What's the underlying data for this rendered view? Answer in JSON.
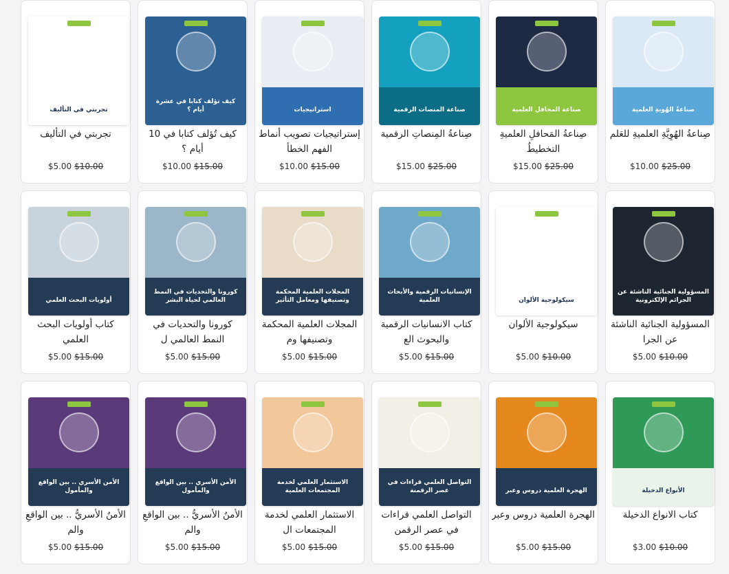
{
  "products": [
    {
      "title": "صِناعةُ الهُوِيَّةِ العلميةِ للعَلم",
      "price": "$10.00",
      "old_price": "$25.00",
      "cover": {
        "text": "صناعةُ الهُويةِ العلمية",
        "bg": "#dbe9f7",
        "band": "#5aa7d9",
        "icon": "world-map"
      }
    },
    {
      "title": "صِناعةُ المَحافلِ العلميةِ التخطيطُ",
      "price": "$15.00",
      "old_price": "$25.00",
      "cover": {
        "text": "صناعة المحافل العلمية",
        "bg": "#1e2a44",
        "band": "#8ec63f",
        "icon": "conference-hall"
      }
    },
    {
      "title": "صِناعةُ المِنصاتِ الرقمية",
      "price": "$15.00",
      "old_price": "$25.00",
      "cover": {
        "text": "صناعة المنصات الرقمية",
        "bg": "#14a0bf",
        "band": "#0c6d87",
        "icon": "cloud-network"
      }
    },
    {
      "title": "إستراتيجيات تصويب أنماط الفهم الخطأ",
      "price": "$10.00",
      "old_price": "$15.00",
      "cover": {
        "text": "استراتيجيات",
        "bg": "#e9eef4",
        "band": "#2f6fb1",
        "icon": "question-mark"
      }
    },
    {
      "title": "كيف تُؤلف كتابا في 10 أيام ؟",
      "price": "$10.00",
      "old_price": "$15.00",
      "cover": {
        "text": "كيف تؤلف كتابا في عشرة أيام ؟",
        "bg": "#2c5f92",
        "band": "#2c5f92",
        "icon": "laptop"
      }
    },
    {
      "title": "تجربتي في التأليف",
      "price": "$5.00",
      "old_price": "$10.00",
      "cover": {
        "text": "تجربتي في التأليف",
        "bg": "#ffffff",
        "band": "#ffffff",
        "icon": "document"
      }
    },
    {
      "title": "المسؤولية الجنائية الناشئة عن الجرا",
      "price": "$5.00",
      "old_price": "$10.00",
      "cover": {
        "text": "المسؤولية الجنائية الناشئة عن الجرائم الإلكترونية",
        "bg": "#1d2530",
        "band": "#1d2530",
        "icon": "lock"
      }
    },
    {
      "title": "سيكولوجية الألوان",
      "price": "$5.00",
      "old_price": "$10.00",
      "cover": {
        "text": "سيكولوجية الألوان",
        "bg": "#ffffff",
        "band": "#ffffff",
        "icon": "color-wheel"
      }
    },
    {
      "title": "كتاب الانسانيات الرقمية والبحوث الع",
      "price": "$5.00",
      "old_price": "$15.00",
      "cover": {
        "text": "الإنسانيات الرقمية والأبحاث العلمية",
        "bg": "#6fa9c9",
        "band": "#243b55",
        "icon": "people"
      }
    },
    {
      "title": "المجلات العلمية المحكمة وتصنيفها وم",
      "price": "$5.00",
      "old_price": "$15.00",
      "cover": {
        "text": "المجلات العلمية المحكمة وتصنيفها ومعامل التأثير",
        "bg": "#e8dcc8",
        "band": "#243b55",
        "icon": "open-book"
      }
    },
    {
      "title": "كورونا والتحديات في النمط العالمي ل",
      "price": "$5.00",
      "old_price": "$15.00",
      "cover": {
        "text": "كورونا والتحديات في النمط العالمي لحياة البشر",
        "bg": "#9bb6c9",
        "band": "#243b55",
        "icon": "virus-dna"
      }
    },
    {
      "title": "كتاب أولويات البحث العلمي",
      "price": "$5.00",
      "old_price": "$15.00",
      "cover": {
        "text": "أولويات البحث العلمي",
        "bg": "#c9d3dc",
        "band": "#243b55",
        "icon": "typing-hands"
      }
    },
    {
      "title": "كتاب الانواع الدخيلة",
      "price": "$3.00",
      "old_price": "$10.00",
      "cover": {
        "text": "الأنواع الدخيلة",
        "bg": "#2f9a58",
        "band": "#e9f3ea",
        "icon": "species"
      }
    },
    {
      "title": "الهجرة العلمية دروس وعبر",
      "price": "$5.00",
      "old_price": "$15.00",
      "cover": {
        "text": "الهجرة العلمية دروس وعبر",
        "bg": "#e5891f",
        "band": "#243b55",
        "icon": "camels"
      }
    },
    {
      "title": "التواصل العلمي قراءات في عصر الرقمن",
      "price": "$5.00",
      "old_price": "$15.00",
      "cover": {
        "text": "التواصل العلمي قراءات في عصر الرقمنة",
        "bg": "#f2efe6",
        "band": "#243b55",
        "icon": "bulb-network"
      }
    },
    {
      "title": "الاستثمار العلمي لخدمة المجتمعات ال",
      "price": "$5.00",
      "old_price": "$15.00",
      "cover": {
        "text": "الاستثمار العلمي لخدمة المجتمعات العلمية",
        "bg": "#f2c79a",
        "band": "#243b55",
        "icon": "hands-brain"
      }
    },
    {
      "title": "الأمنُ الأسريُّ .. بين الواقعِ والم",
      "price": "$5.00",
      "old_price": "$15.00",
      "cover": {
        "text": "الأمن الأسري .. بين الواقع والمأمول",
        "bg": "#5b3a7a",
        "band": "#243b55",
        "icon": "family"
      }
    },
    {
      "title": "الأمنُ الأسريُّ .. بين الواقعِ والم",
      "price": "$5.00",
      "old_price": "$15.00",
      "cover": {
        "text": "الأمن الأسري .. بين الواقع والمأمول",
        "bg": "#5b3a7a",
        "band": "#243b55",
        "icon": "family"
      }
    }
  ]
}
